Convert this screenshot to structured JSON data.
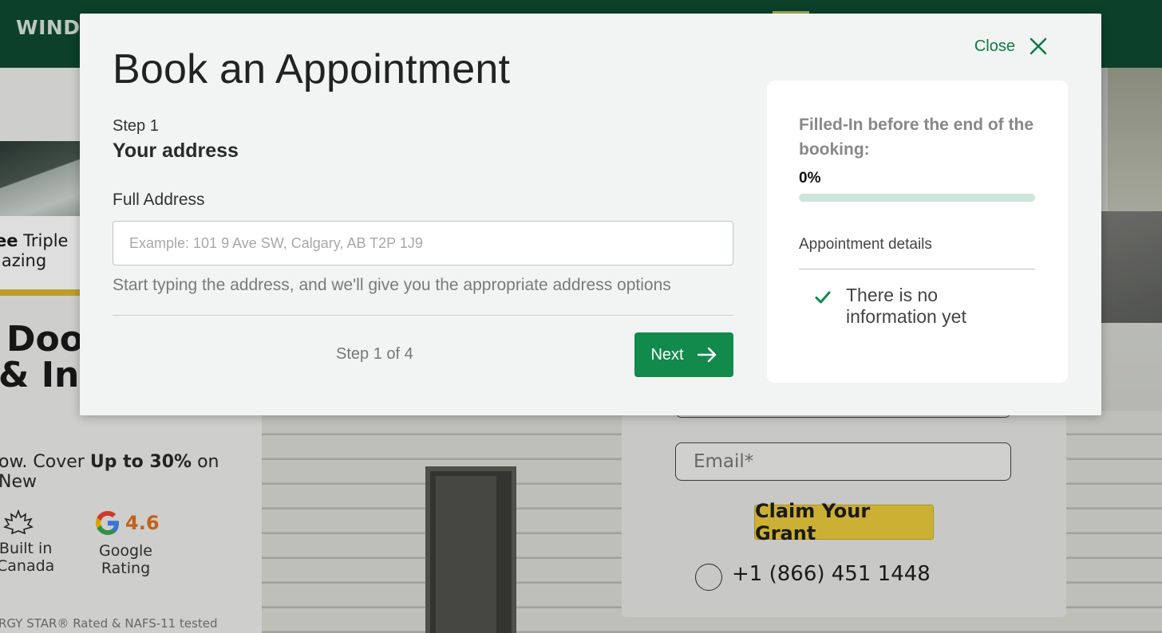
{
  "background_page": {
    "logo": "WINDO",
    "promo_line1": "ee Triple",
    "promo_line2": "lazing",
    "heading_line1": "Doors",
    "heading_line2": "& Inst",
    "cover_prefix": "ow. Cover ",
    "cover_bold": "Up to 30%",
    "cover_suffix": " on New",
    "built_in_line1": "Built in",
    "built_in_line2": "Canada",
    "google_rating_value": "4.6",
    "google_label_line1": "Google",
    "google_label_line2": "Rating",
    "footer_note": "RGY STAR® Rated & NAFS-11 tested",
    "email_placeholder": "Email*",
    "claim_button": "Claim Your Grant",
    "phone": "+1 (866) 451 1448"
  },
  "modal": {
    "title": "Book an Appointment",
    "close_label": "Close",
    "step_label": "Step 1",
    "step_title": "Your address",
    "field_label": "Full Address",
    "address_value": "",
    "address_placeholder": "Example: 101 9 Ave SW, Calgary, AB T2P 1J9",
    "hint": "Start typing the address, and we'll give you the appropriate address options",
    "step_count": "Step 1 of 4",
    "next_label": "Next"
  },
  "summary": {
    "title": "Filled-In before the end of the booking:",
    "progress_percent": 0,
    "progress_text": "0%",
    "details_label": "Appointment details",
    "empty_text": "There is no information yet"
  },
  "colors": {
    "brand_green": "#118a4b",
    "header_green": "#0e4a30",
    "progress_track": "#cce6d9",
    "grant_yellow": "#eacb3b"
  }
}
